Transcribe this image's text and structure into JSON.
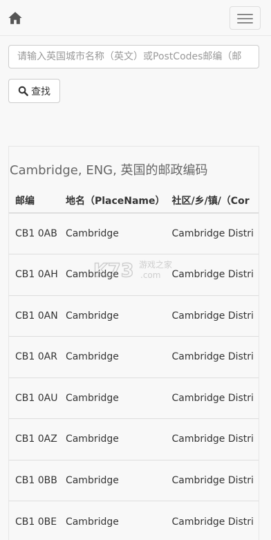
{
  "nav": {
    "home_icon": "home-icon",
    "menu_icon": "hamburger-menu-icon"
  },
  "search": {
    "placeholder": "请输入英国城市名称（英文）或PostCodes邮编（邮",
    "button_label": "查找",
    "button_icon": "search-icon"
  },
  "result": {
    "title": "Cambridge, ENG, 英国的邮政编码",
    "columns": [
      "邮编",
      "地名（PlaceName）",
      "社区/乡/镇/（Cor"
    ],
    "rows": [
      [
        "CB1 0AB",
        "Cambridge",
        "Cambridge Distri"
      ],
      [
        "CB1 0AH",
        "Cambridge",
        "Cambridge Distri"
      ],
      [
        "CB1 0AN",
        "Cambridge",
        "Cambridge Distri"
      ],
      [
        "CB1 0AR",
        "Cambridge",
        "Cambridge Distri"
      ],
      [
        "CB1 0AU",
        "Cambridge",
        "Cambridge Distri"
      ],
      [
        "CB1 0AZ",
        "Cambridge",
        "Cambridge Distri"
      ],
      [
        "CB1 0BB",
        "Cambridge",
        "Cambridge Distri"
      ],
      [
        "CB1 0BE",
        "Cambridge",
        "Cambridge Distri"
      ]
    ]
  },
  "watermark": {
    "logo_text": "K73",
    "sub_text": "游戏之家",
    "domain": ".com"
  }
}
